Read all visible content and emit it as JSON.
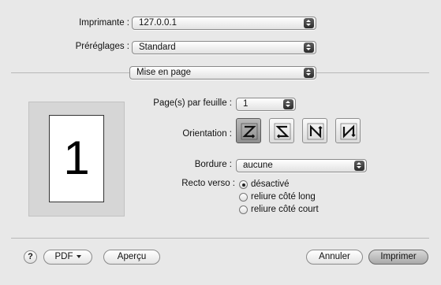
{
  "printer": {
    "label": "Imprimante :",
    "value": "127.0.0.1"
  },
  "presets": {
    "label": "Préréglages :",
    "value": "Standard"
  },
  "panel": {
    "value": "Mise en page"
  },
  "preview": {
    "page_number": "1"
  },
  "layout": {
    "pages_per_sheet_label": "Page(s) par feuille :",
    "pages_per_sheet_value": "1",
    "orientation_label": "Orientation :",
    "orientation_icons": [
      "layout-z-icon",
      "layout-s-icon",
      "layout-n-icon",
      "layout-n-reversed-icon"
    ],
    "border_label": "Bordure :",
    "border_value": "aucune",
    "duplex_label": "Recto verso :",
    "duplex_options": [
      {
        "label": "désactivé",
        "selected": true
      },
      {
        "label": "reliure côté long",
        "selected": false
      },
      {
        "label": "reliure côté court",
        "selected": false
      }
    ]
  },
  "footer": {
    "help": "?",
    "pdf_label": "PDF",
    "preview_label": "Aperçu",
    "cancel_label": "Annuler",
    "print_label": "Imprimer"
  }
}
